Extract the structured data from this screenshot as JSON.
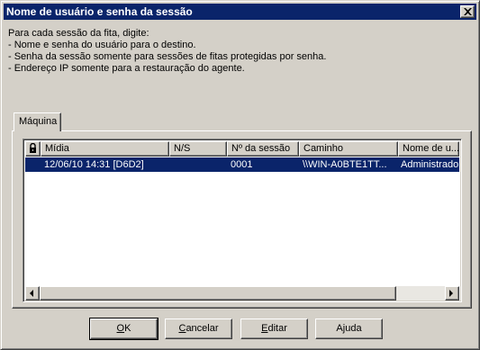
{
  "window": {
    "title": "Nome de usuário e senha da sessão"
  },
  "instructions": [
    "Para cada sessão da fita, digite:",
    "- Nome e senha do usuário para o destino.",
    "- Senha da sessão somente para sessões de fitas protegidas por senha.",
    "- Endereço IP somente para a restauração do agente."
  ],
  "tab": {
    "label": "Máquina"
  },
  "table": {
    "headers": [
      "Mídia",
      "N/S",
      "Nº da sessão",
      "Caminho",
      "Nome de u..."
    ],
    "rows": [
      {
        "midia": "12/06/10 14:31 [D6D2]",
        "ns": "",
        "sessao": "0001",
        "caminho": "\\\\WIN-A0BTE1TT...",
        "usuario": "Administrador"
      }
    ],
    "selected_row": 0
  },
  "buttons": {
    "ok": {
      "label": "OK",
      "accel": "O",
      "rest": "K"
    },
    "cancel": {
      "label": "Cancelar",
      "accel": "C",
      "rest": "ancelar"
    },
    "edit": {
      "label": "Editar",
      "accel": "E",
      "rest": "ditar"
    },
    "help": {
      "label": "Ajuda",
      "pre": "A",
      "accel": "j",
      "rest": "uda"
    }
  },
  "icons": {
    "close": "close-icon",
    "lock_column": "lock-icon",
    "scroll_left": "arrow-left-icon",
    "scroll_right": "arrow-right-icon"
  },
  "colors": {
    "title_bar": "#0a246a",
    "selection": "#0a246a",
    "face": "#d4d0c8"
  }
}
